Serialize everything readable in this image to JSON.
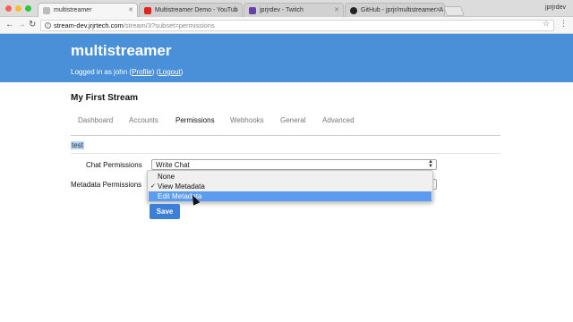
{
  "browser": {
    "tabs": [
      {
        "title": "multistreamer",
        "active": true
      },
      {
        "title": "Multistreamer Demo - YouTub",
        "active": false
      },
      {
        "title": "jprjrdev - Twitch",
        "active": false
      },
      {
        "title": "GitHub - jprjr/multistreamer: A",
        "active": false
      }
    ],
    "profile_name": "jprjrdev",
    "url_host": "stream-dev.jrjrtech.com",
    "url_path": "/stream/3?subset=permissions"
  },
  "header": {
    "title": "multistreamer",
    "logged_in_prefix": "Logged in as john (",
    "profile_link": "Profile",
    "middle": ") (",
    "logout_link": "Logout",
    "suffix": ")"
  },
  "stream": {
    "name": "My First Stream",
    "tabs": [
      "Dashboard",
      "Accounts",
      "Permissions",
      "Webhooks",
      "General",
      "Advanced"
    ],
    "active_tab": "Permissions"
  },
  "permissions": {
    "user": "test",
    "chat_label": "Chat Permissions",
    "chat_value": "Write Chat",
    "metadata_label": "Metadata Permissions",
    "metadata_options": [
      "None",
      "View Metadata",
      "Edit Metadata"
    ],
    "metadata_checked": "View Metadata",
    "metadata_highlighted": "Edit Metadata",
    "save_label": "Save"
  },
  "colors": {
    "header_bg": "#4a90d9",
    "button_bg": "#3b7fd9",
    "highlight": "#5b9bf0"
  }
}
